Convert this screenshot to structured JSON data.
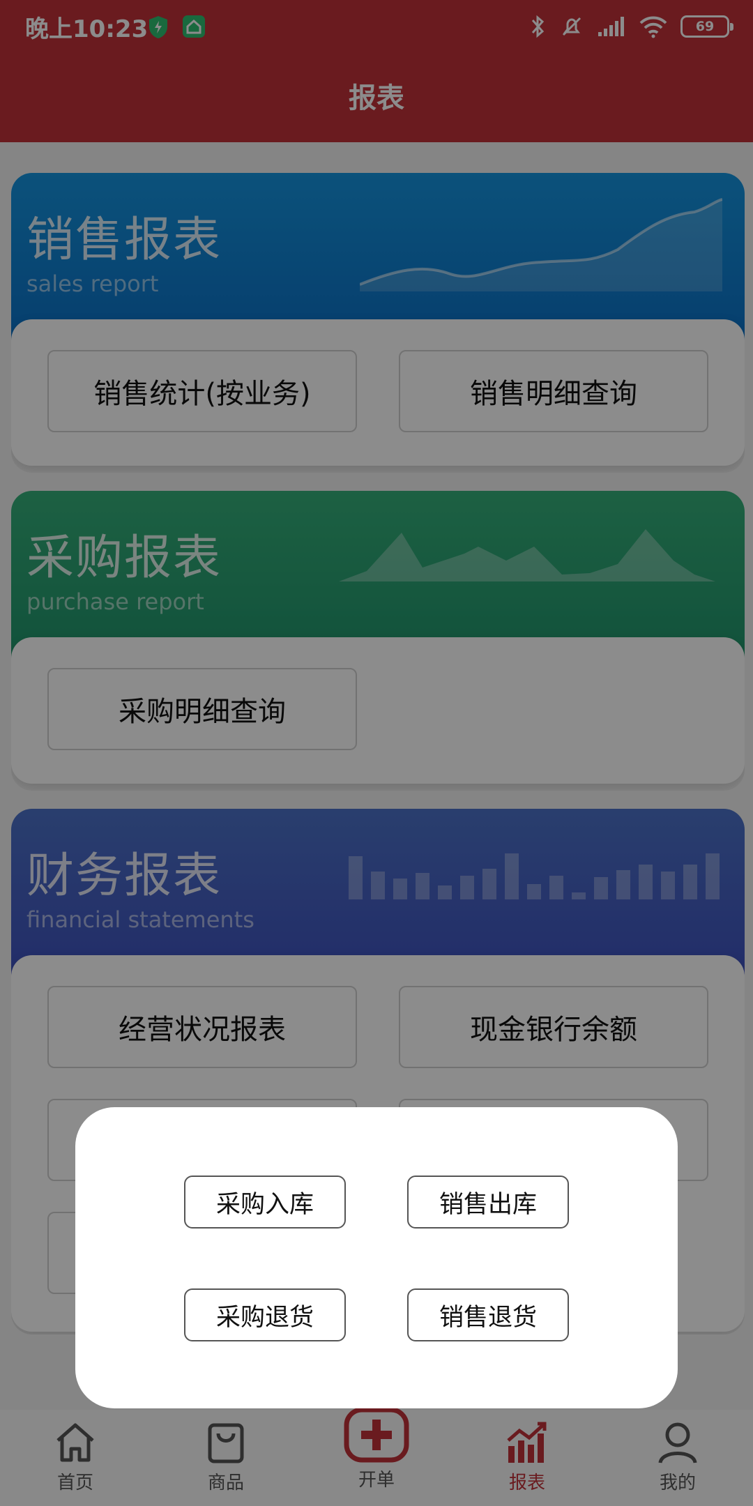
{
  "status": {
    "time": "晚上10:23",
    "battery": "69"
  },
  "header": {
    "title": "报表"
  },
  "sections": {
    "sales": {
      "title": "销售报表",
      "subtitle": "sales report",
      "buttons": [
        "销售统计(按业务)",
        "销售明细查询"
      ]
    },
    "purchase": {
      "title": "采购报表",
      "subtitle": "purchase report",
      "buttons": [
        "采购明细查询"
      ]
    },
    "finance": {
      "title": "财务报表",
      "subtitle": "financial statements",
      "buttons": [
        "经营状况报表",
        "现金银行余额"
      ]
    }
  },
  "dialog": {
    "buttons": [
      "采购入库",
      "销售出库",
      "采购退货",
      "销售退货"
    ]
  },
  "nav": {
    "items": [
      {
        "label": "首页",
        "icon": "home-icon"
      },
      {
        "label": "商品",
        "icon": "bag-icon"
      },
      {
        "label": "开单",
        "icon": "plus-icon"
      },
      {
        "label": "报表",
        "icon": "chart-icon"
      },
      {
        "label": "我的",
        "icon": "person-icon"
      }
    ],
    "active": "报表"
  },
  "colors": {
    "brand_red": "#c1323a",
    "sales_blue": "#1595e0",
    "purchase_green": "#35b07a",
    "finance_indigo": "#4c72c8"
  }
}
